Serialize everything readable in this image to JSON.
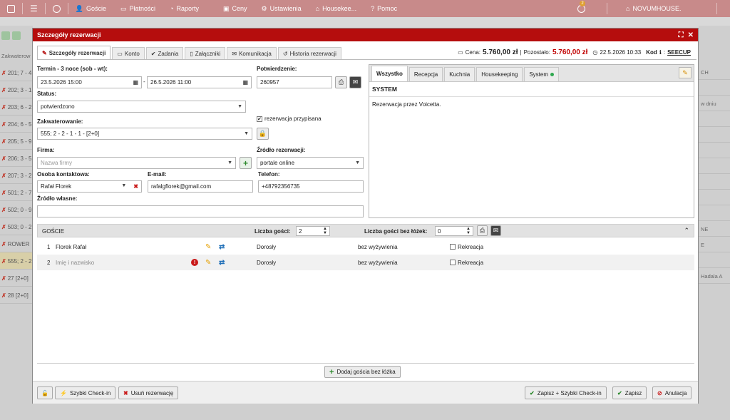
{
  "topbar": {
    "items": [
      "Goście",
      "Płatności",
      "Raporty",
      "Ceny",
      "Ustawienia",
      "Housekee...",
      "Pomoc"
    ],
    "badge": "2",
    "hotel": "NOVUMHOUSE."
  },
  "background": {
    "left_header": "Zakwaterow",
    "left_rows": [
      "201; 7 - 4",
      "202; 3 - 1",
      "203; 6 - 2",
      "204; 6 - 5",
      "205; 5 - 9",
      "206; 3 - 5",
      "207; 3 - 2",
      "501; 2 - 7",
      "502; 0 - 9",
      "503; 0 - 2",
      "ROWER",
      "555; 2 - 2",
      "27 [2+0]",
      "28 [2+0]"
    ],
    "right_rows": [
      "CH",
      "",
      "w dniu",
      "",
      "",
      "",
      "",
      "",
      "",
      "",
      "NE",
      "E",
      "",
      "Hadala A"
    ]
  },
  "modal": {
    "title": "Szczegóły rezerwacji",
    "tabs": [
      "Szczegóły rezerwacji",
      "Konto",
      "Zadania",
      "Załączniki",
      "Komunikacja",
      "Historia rezerwacji"
    ],
    "summary": {
      "price_label": "Cena:",
      "price": "5.760,00 zł",
      "remaining_label": "Pozostało:",
      "remaining": "5.760,00 zł",
      "datetime": "22.5.2026 10:33",
      "code_label": "Kod",
      "code": "SEECUP"
    },
    "form": {
      "term_label": "Termin - 3 noce (sob - wt):",
      "date_from": "23.5.2026 15:00",
      "date_to": "26.5.2026 11:00",
      "confirmation_label": "Potwierdzenie:",
      "confirmation": "260957",
      "status_label": "Status:",
      "status": "potwierdzono",
      "assigned_label": "rezerwacja przypisana",
      "lodging_label": "Zakwaterowanie:",
      "lodging": "555; 2 - 2 - 1 - 1 - [2+0]",
      "company_label": "Firma:",
      "company_placeholder": "Nazwa firmy",
      "source_label": "Źródło rezerwacji:",
      "source": "portale online",
      "contact_label": "Osoba kontaktowa:",
      "contact": "Rafał Florek",
      "email_label": "E-mail:",
      "email": "rafalgflorek@gmail.com",
      "phone_label": "Telefon:",
      "phone": "+48792356735",
      "own_source_label": "Źródło własne:",
      "own_source": ""
    },
    "notes": {
      "tabs": [
        "Wszystko",
        "Recepcja",
        "Kuchnia",
        "Housekeeping",
        "System"
      ],
      "section": "SYSTEM",
      "message": "Rezerwacja przez Voicetta."
    },
    "guests": {
      "header": "GOŚCIE",
      "count_label": "Liczba gości:",
      "count": "2",
      "nobed_label": "Liczba gości bez łóżek:",
      "nobed": "0",
      "rows": [
        {
          "no": "1",
          "name": "Florek Rafał",
          "placeholder": false,
          "type": "Dorosły",
          "board": "bez wyżywienia",
          "rec": "Rekreacja"
        },
        {
          "no": "2",
          "name": "Imię i nazwisko",
          "placeholder": true,
          "type": "Dorosły",
          "board": "bez wyżywienia",
          "rec": "Rekreacja"
        }
      ],
      "add_nobed": "Dodaj gościa bez łóżka"
    },
    "footer": {
      "quick_checkin": "Szybki Check-in",
      "delete": "Usuń rezerwację",
      "save_checkin": "Zapisz + Szybki Check-in",
      "save": "Zapisz",
      "cancel": "Anulacja"
    }
  }
}
